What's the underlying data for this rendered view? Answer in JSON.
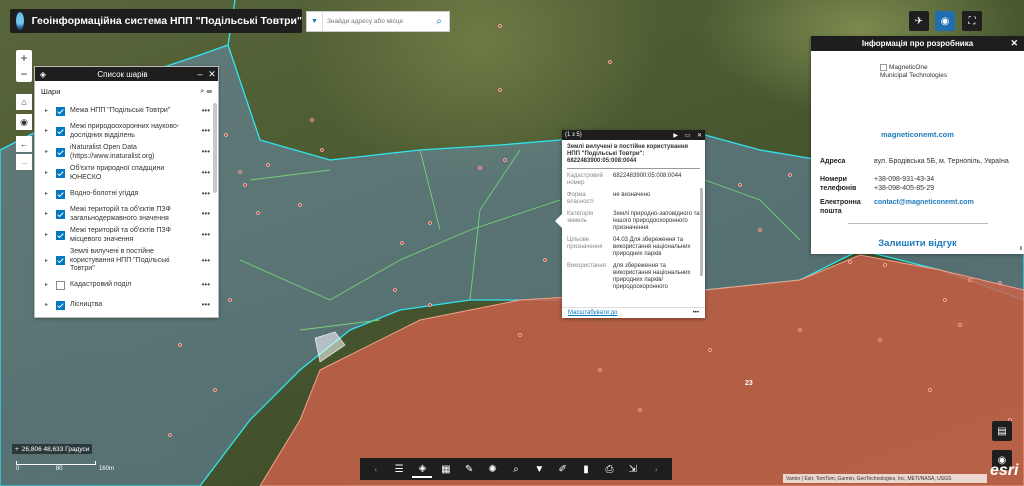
{
  "app": {
    "title": "Геоінформаційна система НПП \"Подільські Товтри\"",
    "search_placeholder": "Знайди адресу або місце"
  },
  "layer_list": {
    "title": "Список шарів",
    "section": "Шари",
    "items": [
      {
        "label": "Межа НПП \"Подільські Товтри\"",
        "checked": true
      },
      {
        "label": "Межі природоохоронних науково-дослідних відділень",
        "checked": true
      },
      {
        "label": "iNaturalist Open Data (https://www.inaturalist.org)",
        "checked": true
      },
      {
        "label": "Об'єкти природної спадщини ЮНЕСКО",
        "checked": true
      },
      {
        "label": "Водно-болотні угіддя",
        "checked": true
      },
      {
        "label": "Межі територій та об'єктів ПЗФ загальнодержавного значення",
        "checked": true
      },
      {
        "label": "Межі територій та об'єктів ПЗФ місцевого значення",
        "checked": true
      },
      {
        "label": "Землі вилучені в постійне користування НПП \"Подільські Товтри\"",
        "checked": true
      },
      {
        "label": "Кадастровий поділ",
        "checked": false
      },
      {
        "label": "Лісництва",
        "checked": true
      }
    ]
  },
  "popup": {
    "counter": "(1 з 5)",
    "title": "Землі вилучені в постійне користування НПП \"Подільські Товтри\": 6822483900:05:008:0044",
    "rows": [
      {
        "key": "Кадастровий номер",
        "value": "6822483900:05:008:0044"
      },
      {
        "key": "Форма власності",
        "value": "не визначено"
      },
      {
        "key": "Категорія земель",
        "value": "Землі природно-заповідного та іншого природоохоронного призначення"
      },
      {
        "key": "Цільове призначення",
        "value": "04.03 Для збереження та використання національних природних парків"
      },
      {
        "key": "Використання",
        "value": "для збереження та використання національних природних парків/природоохоронного"
      }
    ],
    "zoom_link": "Масштабувати до",
    "more": "•••"
  },
  "developer_info": {
    "title": "Інформація про розробника",
    "brand_alt": "MagneticOne",
    "brand_sub": "Municipal Technologies",
    "website": "magneticonemt.com",
    "address_label": "Адреса",
    "address": "вул. Бродівська 5Б, м. Тернопіль, Україна",
    "phones_label": "Номери телефонів",
    "phone1": "+38-098-931-43-34",
    "phone2": "+38-098-405-85-29",
    "email_label": "Електронна пошта",
    "email": "contact@magneticonemt.com",
    "feedback": "Залишити відгук"
  },
  "status": {
    "coordinates": "26,806 48,633 Градуси",
    "scale_labels": [
      "0",
      "80",
      "160m"
    ],
    "attribution": "Vantor | Esri, TomTom, Garmin, GeoTechnologies, Inc, METI/NASA, USGS",
    "esri": "esri",
    "parcel_label": "23"
  },
  "colors": {
    "accent": "#0079c1",
    "header": "#1e1e1e",
    "parcel_fill": "#c8624a",
    "boundary_cyan": "#2ee6f0",
    "boundary_green": "#7be07b"
  }
}
